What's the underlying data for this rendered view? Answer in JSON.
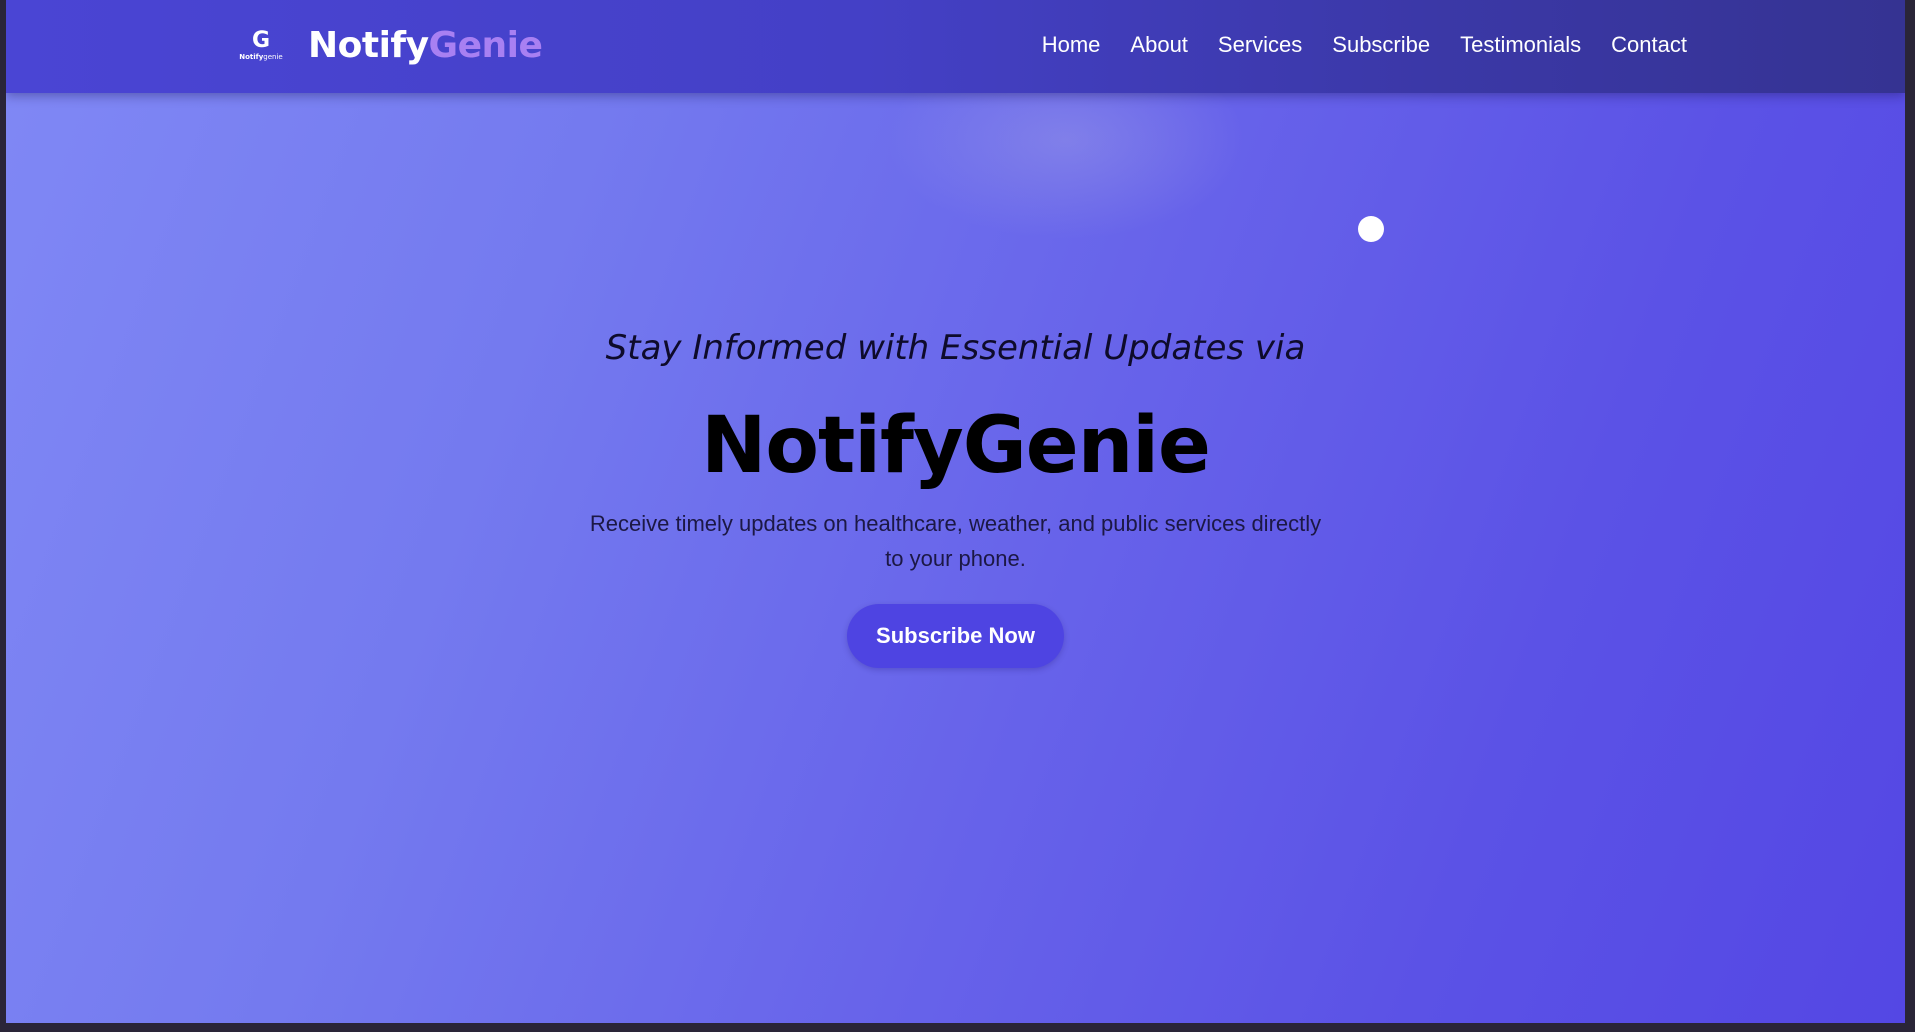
{
  "brand": {
    "logo_letter": "G",
    "logo_sub_bold": "Notify",
    "logo_sub_rest": "genie",
    "name_part1": "Notify",
    "name_part2": "Genie"
  },
  "nav": {
    "items": [
      {
        "label": "Home"
      },
      {
        "label": "About"
      },
      {
        "label": "Services"
      },
      {
        "label": "Subscribe"
      },
      {
        "label": "Testimonials"
      },
      {
        "label": "Contact"
      }
    ]
  },
  "hero": {
    "tagline": "Stay Informed with Essential Updates via",
    "title": "NotifyGenie",
    "description": "Receive timely updates on healthcare, weather, and public services directly to your phone.",
    "cta_label": "Subscribe Now"
  },
  "colors": {
    "nav_bg": "#4440c6",
    "brand_accent": "#a880f2",
    "button_bg": "#4e44e2",
    "hero_gradient_start": "#8088f5",
    "hero_gradient_end": "#5447e4"
  }
}
